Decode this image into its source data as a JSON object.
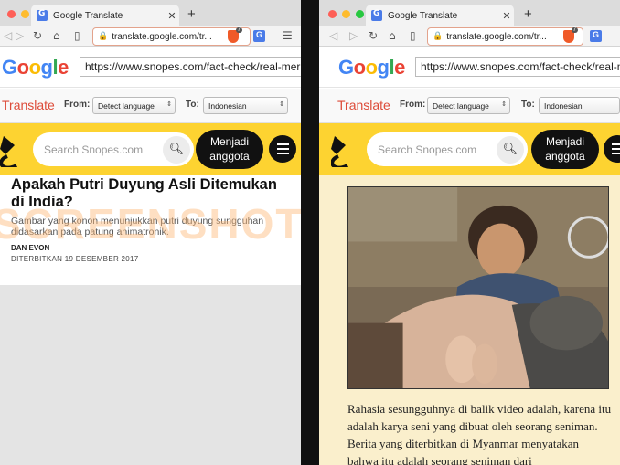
{
  "colors": {
    "close": "#fe5f57",
    "minimize": "#febc2e",
    "maximize": "#28c840",
    "snopes_yellow": "#fdd331",
    "translate_red": "#dd4b39",
    "watermark": "#fdb778"
  },
  "left": {
    "tab_title": "Google Translate",
    "tab_close": "✕",
    "new_tab": "+",
    "url": "translate.google.com/tr...",
    "brave_count": "7",
    "google_url": "https://www.snopes.com/fact-check/real-mermai",
    "translate_label": "Translate",
    "from_label": "From:",
    "from_value": "Detect language",
    "to_label": "To:",
    "to_value": "Indonesian",
    "search_placeholder": "Search Snopes.com",
    "join_line1": "Menjadi",
    "join_line2": "anggota",
    "article_title": "Apakah Putri Duyung Asli Ditemukan di India?",
    "article_sub": "Gambar yang konon menunjukkan putri duyung sungguhan didasarkan pada patung animatronik.",
    "author": "DAN EVON",
    "date": "DITERBITKAN 19 DESEMBER 2017",
    "watermark": "SCREENSHOT"
  },
  "right": {
    "tab_title": "Google Translate",
    "tab_close": "✕",
    "new_tab": "+",
    "url": "translate.google.com/tr...",
    "brave_count": "7",
    "google_url": "https://www.snopes.com/fact-check/real-mermai",
    "translate_label": "Translate",
    "from_label": "From:",
    "from_value": "Detect language",
    "to_label": "To:",
    "to_value": "Indonesian",
    "search_placeholder": "Search Snopes.com",
    "join_line1": "Menjadi",
    "join_line2": "anggota",
    "body_text": "Rahasia sesungguhnya di balik video adalah, karena itu adalah karya seni yang dibuat oleh seorang seniman. Berita yang diterbitkan di Myanmar menyatakan bahwa itu adalah seorang seniman dari"
  },
  "icons": {
    "back": "back-arrow-icon",
    "forward": "forward-arrow-icon",
    "reload": "reload-icon",
    "home": "home-icon",
    "bookmark": "bookmark-icon",
    "lock": "lock-icon",
    "search": "search-icon",
    "menu": "hamburger-menu-icon"
  }
}
